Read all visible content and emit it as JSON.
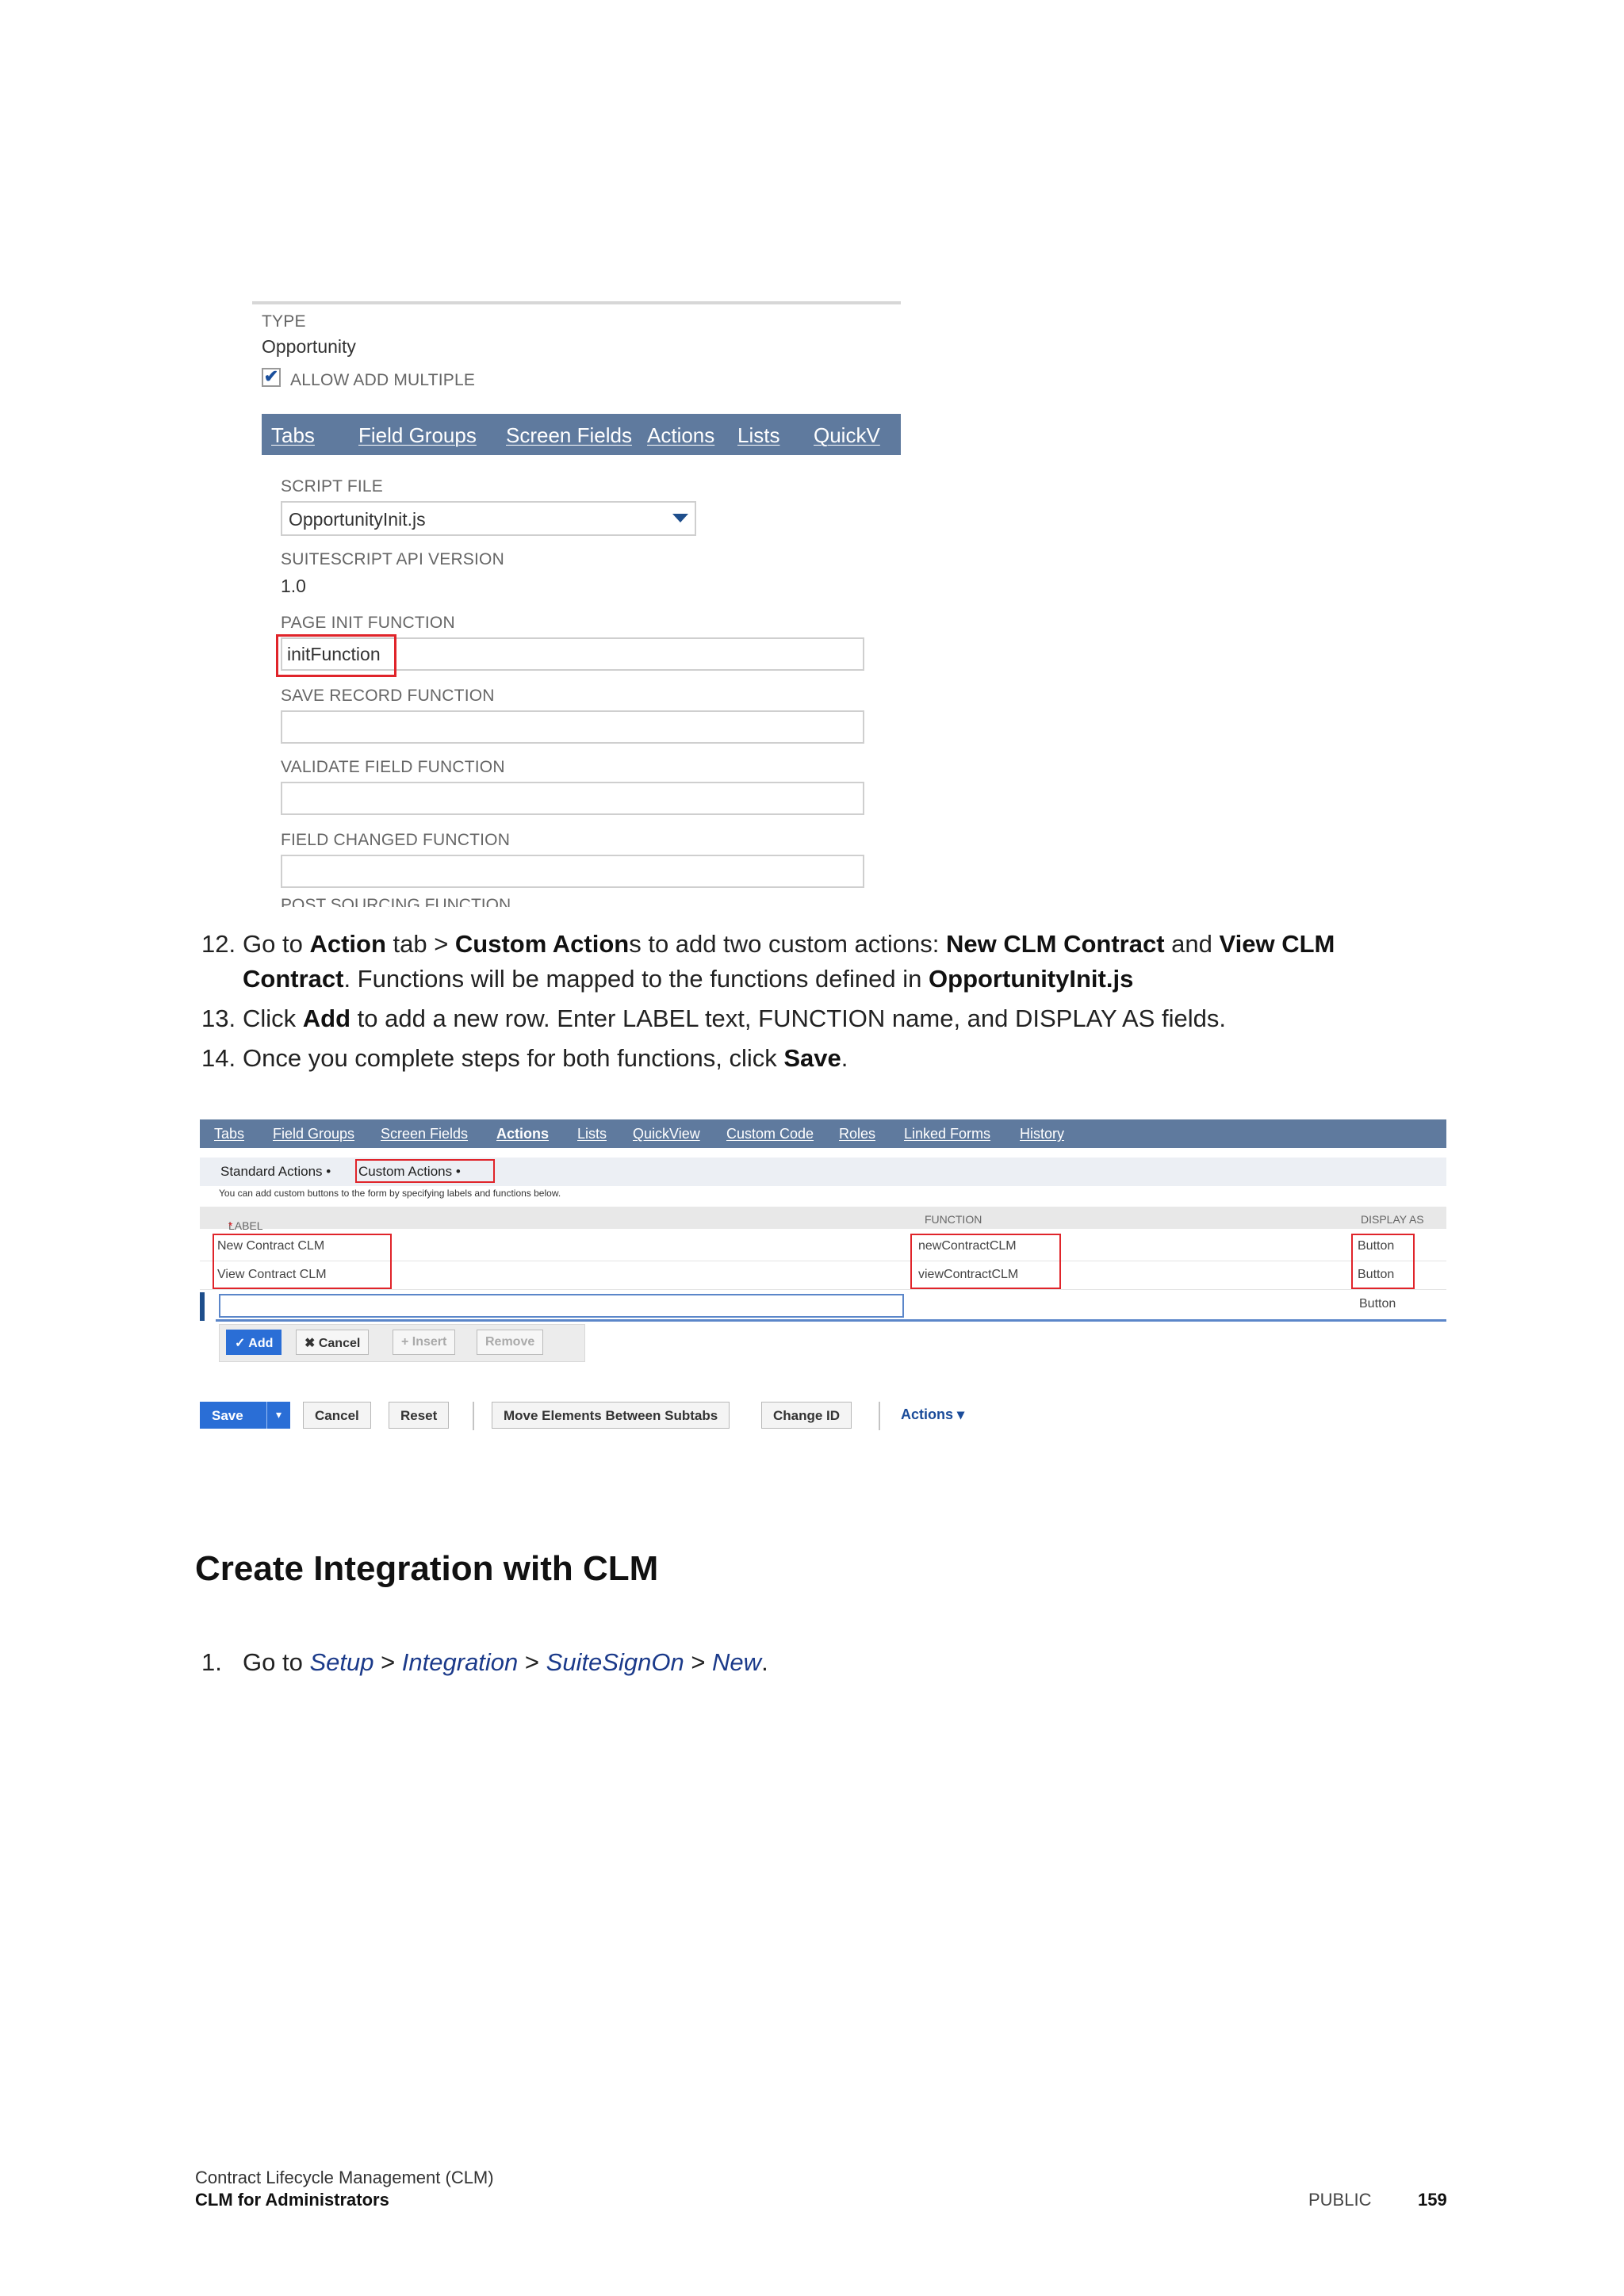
{
  "form_screenshot": {
    "type_label": "TYPE",
    "type_value": "Opportunity",
    "allow_add_multiple": "ALLOW ADD MULTIPLE",
    "tabs": [
      "Tabs",
      "Field Groups",
      "Screen Fields",
      "Actions",
      "Lists",
      "QuickV"
    ],
    "script_file_label": "SCRIPT FILE",
    "script_file_value": "OpportunityInit.js",
    "api_version_label": "SUITESCRIPT API VERSION",
    "api_version_value": "1.0",
    "page_init_label": "PAGE INIT FUNCTION",
    "page_init_value": "initFunction",
    "save_record_label": "SAVE RECORD FUNCTION",
    "validate_field_label": "VALIDATE FIELD FUNCTION",
    "field_changed_label": "FIELD CHANGED FUNCTION",
    "post_sourcing_label": "POST SOURCING FUNCTION"
  },
  "steps": {
    "s12": {
      "num": "12.",
      "go_to": "Go to ",
      "action": "Action",
      "tab_gt": " tab > ",
      "custom_action": "Custom Action",
      "rest1": "s to add two custom actions: ",
      "new_clm": "New CLM Contract",
      "and": " and ",
      "view_clm": "View CLM",
      "contract": "Contract",
      "rest2": ". Functions will be mapped to the functions defined in ",
      "file": "OpportunityInit.js"
    },
    "s13": {
      "num": "13.",
      "click": "Click ",
      "add": "Add",
      "rest": " to add a new row. Enter LABEL text, FUNCTION name, and DISPLAY AS fields."
    },
    "s14": {
      "num": "14.",
      "pre": "Once you complete steps for both functions, click ",
      "save": "Save",
      "post": "."
    }
  },
  "actions_screenshot": {
    "tabs": [
      "Tabs",
      "Field Groups",
      "Screen Fields",
      "Actions",
      "Lists",
      "QuickView",
      "Custom Code",
      "Roles",
      "Linked Forms",
      "History"
    ],
    "subtabs": [
      "Standard Actions •",
      "Custom Actions •"
    ],
    "help_text": "You can add custom buttons to the form by specifying labels and functions below.",
    "columns": {
      "label": "LABEL",
      "required": "*",
      "function": "FUNCTION",
      "display_as": "DISPLAY AS"
    },
    "rows": [
      {
        "label": "New Contract CLM",
        "function": "newContractCLM",
        "display_as": "Button"
      },
      {
        "label": "View Contract CLM",
        "function": "viewContractCLM",
        "display_as": "Button"
      }
    ],
    "edit_row_display": "Button",
    "buttons": {
      "add": "✓ Add",
      "cancel": "✖ Cancel",
      "insert": "+ Insert",
      "remove": "Remove"
    }
  },
  "button_bar": {
    "save": "Save",
    "save_arrow": "▾",
    "cancel": "Cancel",
    "reset": "Reset",
    "move": "Move Elements Between Subtabs",
    "change_id": "Change ID",
    "actions": "Actions ▾"
  },
  "section": {
    "heading": "Create Integration with CLM",
    "step1": {
      "num": "1.",
      "go_to": "Go to ",
      "setup": "Setup",
      "integration": "Integration",
      "suitesignon": "SuiteSignOn",
      "new": "New",
      "sep": " > ",
      "end": "."
    }
  },
  "footer": {
    "product": "Contract Lifecycle Management (CLM)",
    "doc": "CLM for Administrators",
    "classification": "PUBLIC",
    "page": "159"
  },
  "colors": {
    "accent_red": "#e0242a",
    "tab_bar": "#5f7a9e",
    "link": "#1b3a8a",
    "primary_button": "#2a6ed6"
  }
}
